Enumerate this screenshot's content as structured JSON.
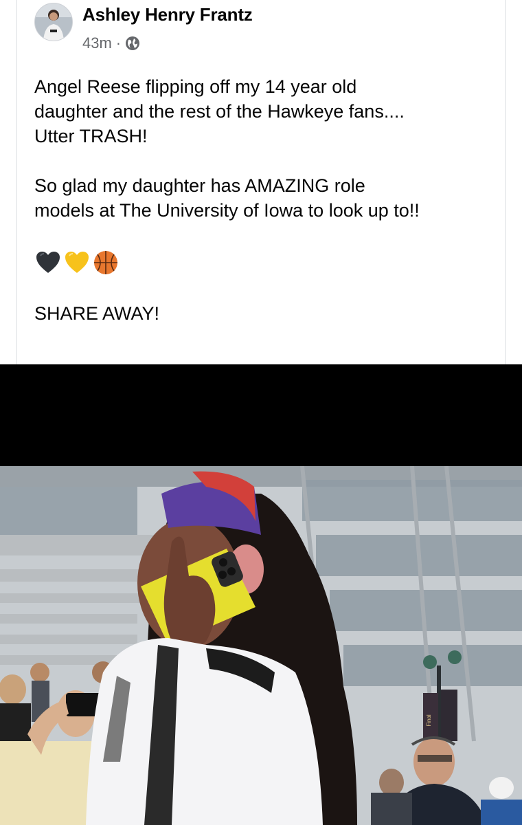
{
  "post": {
    "author": "Ashley Henry Frantz",
    "time": "43m",
    "separator": "·",
    "privacy_icon": "globe-icon",
    "lines": [
      "Angel Reese flipping off my 14 year old",
      "daughter and the rest of the Hawkeye fans....",
      "Utter TRASH!"
    ],
    "lines2": [
      "So glad my daughter has AMAZING role",
      "models at The University of Iowa to look up to!!"
    ],
    "emojis": [
      "black-heart-icon",
      "yellow-heart-icon",
      "basketball-icon"
    ],
    "closing": "SHARE AWAY!"
  },
  "photo": {
    "banner_text": "Final"
  },
  "colors": {
    "text": "#050505",
    "meta": "#65676b",
    "band": "#000000"
  }
}
